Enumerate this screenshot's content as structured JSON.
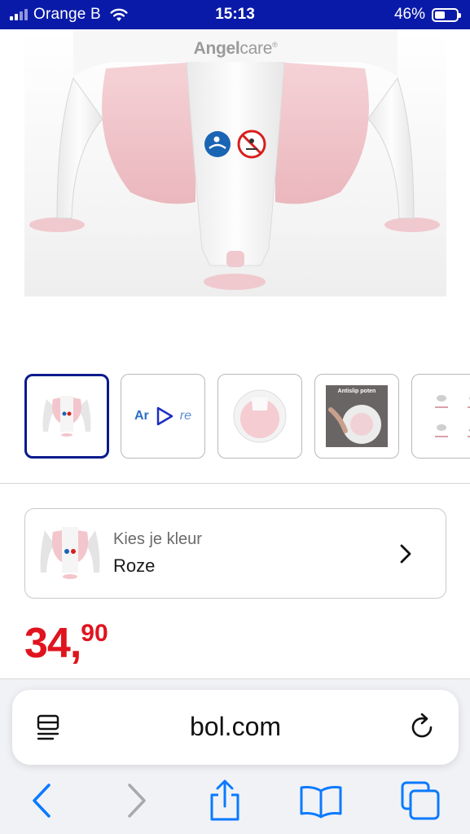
{
  "status_bar": {
    "carrier": "Orange B",
    "time": "15:13",
    "battery_text": "46%",
    "battery_level": 0.46
  },
  "product": {
    "brand_logo_part1": "Angel",
    "brand_logo_part2": "care",
    "brand_logo_mark": "®",
    "thumbnails": [
      {
        "kind": "image",
        "selected": true
      },
      {
        "kind": "video",
        "label_left": "Ar",
        "label_right": "re"
      },
      {
        "kind": "image",
        "selected": false
      },
      {
        "kind": "image",
        "caption": "Antislip poten"
      },
      {
        "kind": "image",
        "selected": false
      }
    ],
    "color_selector": {
      "caption": "Kies je kleur",
      "value": "Roze"
    },
    "price": {
      "euros": "34,",
      "cents": "90"
    }
  },
  "browser": {
    "address": "bol.com"
  },
  "colors": {
    "status_bar_bg": "#0a1aa8",
    "price_red": "#e0141e",
    "selected_thumb_border": "#0a1a8c",
    "ios_blue": "#0a7aff",
    "product_pink": "#f2c6cc"
  },
  "icons": {
    "wifi": "wifi-icon",
    "battery": "battery-icon",
    "chevron": "chevron-right-icon",
    "reader": "reader-mode-icon",
    "reload": "reload-icon",
    "back": "back-arrow-icon",
    "forward": "forward-arrow-icon",
    "share": "share-icon",
    "bookmarks": "bookmarks-icon",
    "tabs": "tabs-icon"
  }
}
